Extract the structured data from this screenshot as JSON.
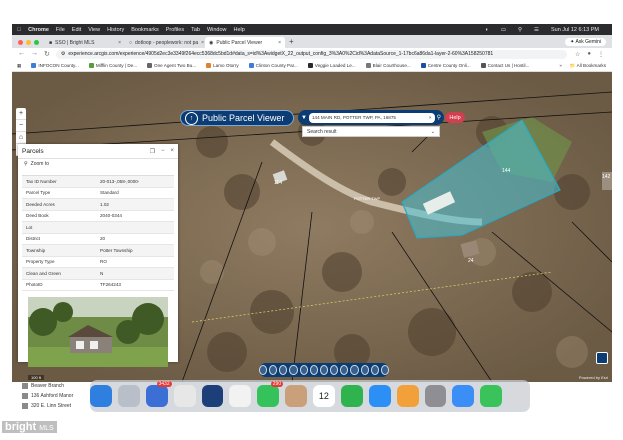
{
  "menubar": {
    "items": [
      "Chrome",
      "File",
      "Edit",
      "View",
      "History",
      "Bookmarks",
      "Profiles",
      "Tab",
      "Window",
      "Help"
    ],
    "datetime": "Sun Jul 12  6:13 PM"
  },
  "tabs": [
    {
      "label": "SSO | Bright MLS",
      "active": false
    },
    {
      "label": "dotloop - peoplework: not pa",
      "active": false
    },
    {
      "label": "Public Parcel Viewer",
      "active": true
    }
  ],
  "ask_gemini": "Ask Gemini",
  "url": "experience.arcgis.com/experience/4905d2ec3e3349f264ecc5368dc5bd1d#data_s=id%3AwidgetX_22_output_config_3%3A0%2Cid%3AdataSource_1-17bc6a86da1-layer-2-60%3A158250781",
  "bookmarks": [
    "INFOCON County...",
    "Mifflin County | De...",
    "One Agent Two Bu...",
    "Lamo Otorry",
    "Clinton County Par...",
    "Veggie Loaded Le...",
    "Blair Courthouse...",
    "Centre County Onli...",
    "Contact Us | Hostil..."
  ],
  "all_bookmarks": "All Bookmarks",
  "viewer": {
    "title": "Public Parcel Viewer",
    "search_value": "144 MAIN RD, POTTER TWP, PA, 16875",
    "search_result": "Search result",
    "help": "Help"
  },
  "map_labels": {
    "parcel_a": "144",
    "parcel_b": "114",
    "parcel_c": "142",
    "parcel_d": "24",
    "road": "POTTER TWP",
    "scale": "100 ft",
    "esri": "Powered by Esri"
  },
  "panel": {
    "title": "Parcels",
    "zoom_to": "Zoom to",
    "attributes": [
      {
        "key": "Tax ID Number",
        "value": "20-013-,058-,0000-"
      },
      {
        "key": "Parcel Type",
        "value": "Standard"
      },
      {
        "key": "Deeded Acres",
        "value": "1.02"
      },
      {
        "key": "Deed Book",
        "value": "2040-0344"
      },
      {
        "key": "Lot",
        "value": ""
      },
      {
        "key": "District",
        "value": "20"
      },
      {
        "key": "Township",
        "value": "Potter Township"
      },
      {
        "key": "Property Type",
        "value": "RO"
      },
      {
        "key": "Clean and Green",
        "value": "N"
      },
      {
        "key": "PhotoID",
        "value": "TF264243"
      }
    ]
  },
  "side_list": [
    "Beaver Branch",
    "136 Ashford Manor",
    "320 E. Linn Street"
  ],
  "dock": [
    {
      "name": "finder",
      "color": "#2f7fe0",
      "badge": ""
    },
    {
      "name": "launchpad",
      "color": "#b9bfc8",
      "badge": ""
    },
    {
      "name": "messages-app",
      "color": "#3b6fd6",
      "badge": "3432"
    },
    {
      "name": "chrome",
      "color": "#e7e7e7",
      "badge": ""
    },
    {
      "name": "app-blue",
      "color": "#1d3f79",
      "badge": ""
    },
    {
      "name": "photos",
      "color": "#f2f2f2",
      "badge": ""
    },
    {
      "name": "messages",
      "color": "#36c25a",
      "badge": "290"
    },
    {
      "name": "contacts",
      "color": "#c9a07a",
      "badge": ""
    },
    {
      "name": "calendar",
      "color": "#ffffff",
      "badge": "",
      "text": "12"
    },
    {
      "name": "facetime",
      "color": "#2fb34f",
      "badge": ""
    },
    {
      "name": "app-store",
      "color": "#2b8ff5",
      "badge": ""
    },
    {
      "name": "pages",
      "color": "#f2a03a",
      "badge": ""
    },
    {
      "name": "settings",
      "color": "#8e8e93",
      "badge": ""
    },
    {
      "name": "mail",
      "color": "#3a8ef5",
      "badge": ""
    },
    {
      "name": "facetime2",
      "color": "#3ac35a",
      "badge": ""
    },
    {
      "name": "trash",
      "color": "#d7d9dc",
      "badge": ""
    }
  ],
  "watermark": {
    "brand": "bright",
    "suffix": "MLS"
  }
}
